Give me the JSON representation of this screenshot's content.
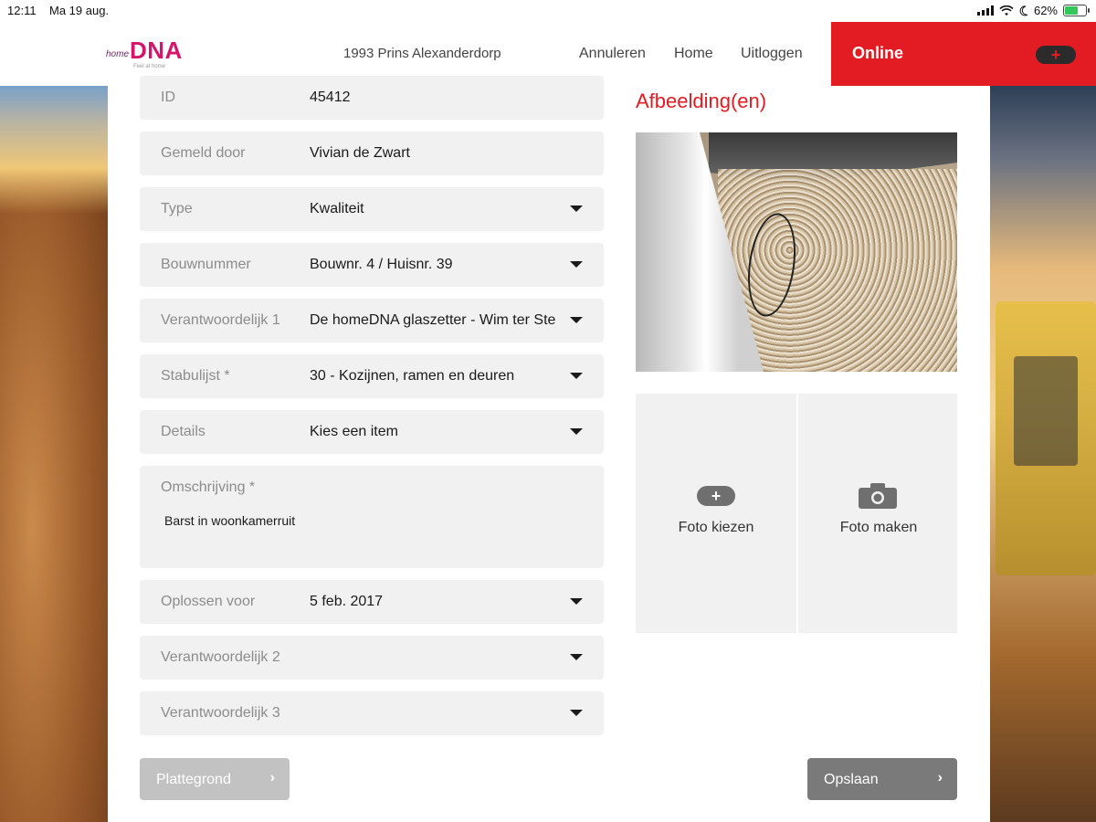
{
  "status": {
    "time": "12:11",
    "date": "Ma 19 aug.",
    "battery": "62%"
  },
  "header": {
    "logo_home": "home",
    "logo_dna": "DNA",
    "logo_sub": "Feel at home",
    "project": "1993 Prins Alexanderdorp",
    "nav": [
      "Annuleren",
      "Home",
      "Uitloggen"
    ],
    "online_label": "Online",
    "add_symbol": "+"
  },
  "form": {
    "fields": [
      {
        "label": "ID",
        "value": "45412",
        "dropdown": false
      },
      {
        "label": "Gemeld door",
        "value": "Vivian de Zwart",
        "dropdown": false
      },
      {
        "label": "Type",
        "value": "Kwaliteit",
        "dropdown": true
      },
      {
        "label": "Bouwnummer",
        "value": "Bouwnr. 4 / Huisnr. 39",
        "dropdown": true
      },
      {
        "label": "Verantwoordelijk 1",
        "value": "De homeDNA glaszetter - Wim ter Ste",
        "dropdown": true
      },
      {
        "label": "Stabulijst *",
        "value": "30 - Kozijnen, ramen en deuren",
        "dropdown": true
      },
      {
        "label": "Details",
        "value": "Kies een item",
        "dropdown": true
      },
      {
        "label": "Omschrijving *",
        "value": "Barst in woonkamerruit",
        "dropdown": false
      },
      {
        "label": "Oplossen voor",
        "value": "5 feb. 2017",
        "dropdown": true
      },
      {
        "label": "Verantwoordelijk 2",
        "value": "",
        "dropdown": true
      },
      {
        "label": "Verantwoordelijk 3",
        "value": "",
        "dropdown": true
      }
    ],
    "plattegrond_label": "Plattegrond",
    "opslaan_label": "Opslaan",
    "chevron": "›"
  },
  "images": {
    "title": "Afbeelding(en)",
    "foto_kiezen": "Foto kiezen",
    "foto_maken": "Foto maken"
  },
  "colors": {
    "accent_red": "#e31b23",
    "brand_pink": "#d3166b",
    "field_bg": "#f1f1f1"
  }
}
